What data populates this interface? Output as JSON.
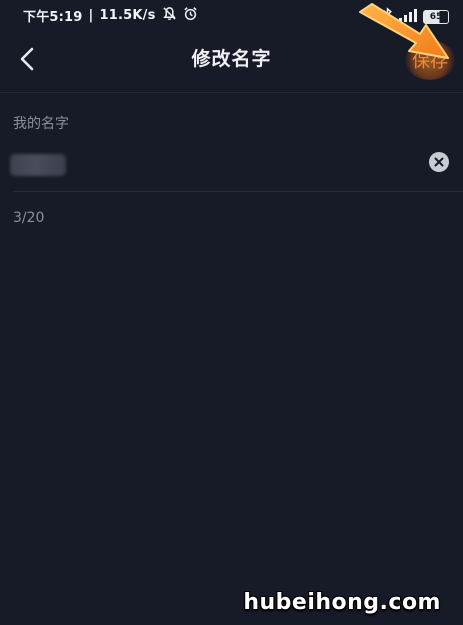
{
  "status_bar": {
    "time": "下午5:19",
    "separator": "|",
    "network_speed": "11.5K/s",
    "icons": [
      "mute-bell-icon",
      "alarm-clock-icon",
      "bluetooth-icon",
      "signal-icon",
      "battery-icon"
    ],
    "battery_level": "65"
  },
  "header": {
    "back_icon": "chevron-left-icon",
    "title": "修改名字",
    "save_label": "保存"
  },
  "form": {
    "field_label": "我的名字",
    "name_value": "",
    "clear_icon": "close-circle-icon",
    "char_count": "3/20"
  },
  "overlay": {
    "annotation_icon": "orange-arrow-icon",
    "highlight_color": "#f39a2e"
  },
  "watermark": {
    "text": "hubeihong.com"
  },
  "colors": {
    "background": "#171a27",
    "text_primary": "#f0f1f4",
    "text_secondary": "#8d909c",
    "accent": "#f18a3a"
  }
}
